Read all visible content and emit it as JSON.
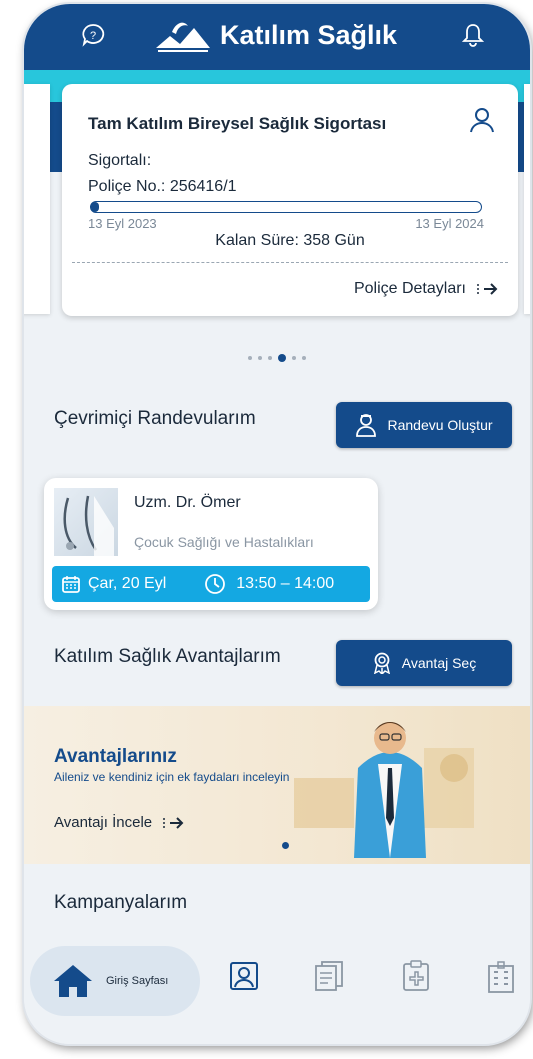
{
  "header": {
    "brand": "Katılım Sağlık",
    "icons": [
      "help-chat-icon",
      "logo-icon",
      "bell-icon"
    ]
  },
  "policy_card": {
    "title": "Tam Katılım Bireysel Sağlık Sigortası",
    "insured_label": "Sigortalı:",
    "policy_no": "Poliçe No.: 256416/1",
    "start_date": "13 Eyl 2023",
    "end_date": "13 Eyl 2024",
    "progress": 0.02,
    "remaining": "Kalan Süre: 358 Gün",
    "details_link": "Poliçe Detayları"
  },
  "carousel": {
    "count": 6,
    "active_index": 3
  },
  "appointments": {
    "title": "Çevrimiçi Randevularım",
    "create_button": "Randevu Oluştur",
    "item": {
      "doctor": "Uzm. Dr. Ömer",
      "specialty": "Çocuk Sağlığı ve Hastalıkları",
      "date": "Çar, 20 Eyl",
      "time": "13:50 – 14:00"
    }
  },
  "advantages": {
    "title": "Katılım Sağlık Avantajlarım",
    "select_button": "Avantaj Seç",
    "banner_title": "Avantajlarınız",
    "banner_subtitle": "Aileniz ve kendiniz için ek faydaları inceleyin",
    "banner_link": "Avantajı İncele"
  },
  "campaigns": {
    "title": "Kampanyalarım"
  },
  "bottom_nav": {
    "home_label": "Giriş Sayfası",
    "items": [
      "home-icon",
      "profile-card-icon",
      "documents-icon",
      "health-clipboard-icon",
      "hospital-icon"
    ]
  },
  "colors": {
    "primary": "#144b8b",
    "teal": "#28c6dc",
    "accent": "#14a8e2",
    "background": "#eef2f6"
  }
}
